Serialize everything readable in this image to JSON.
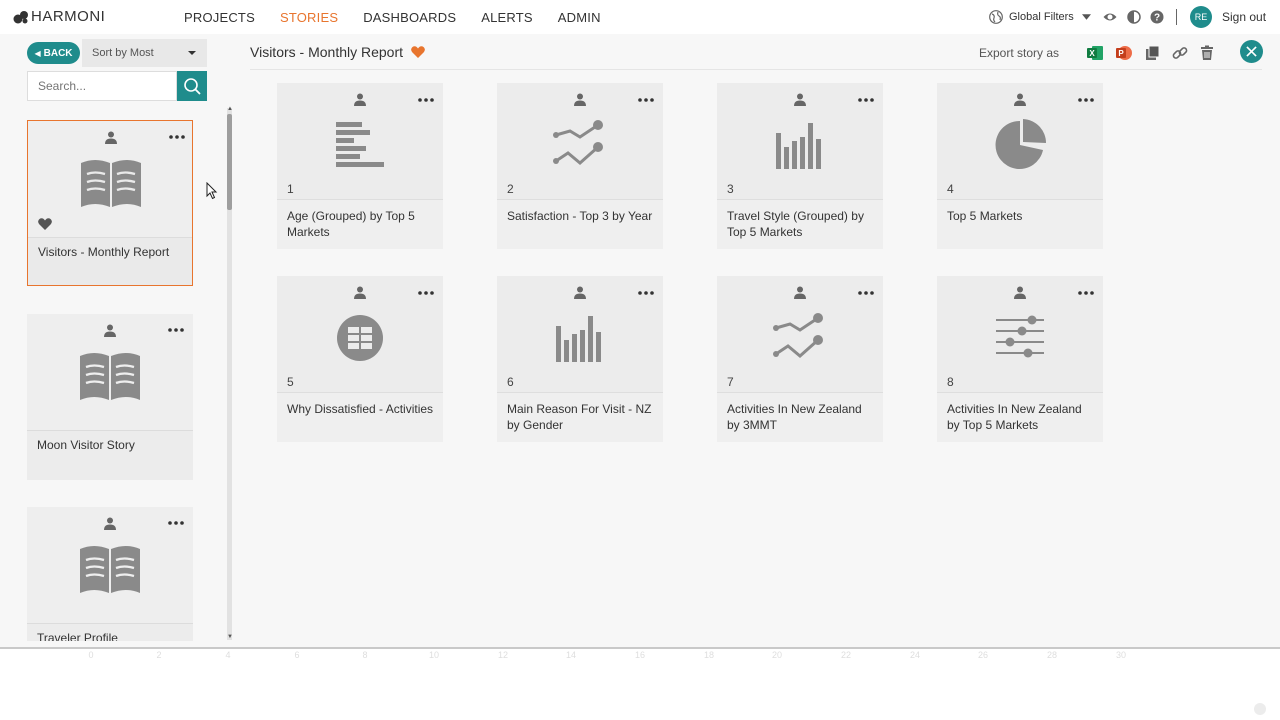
{
  "app": {
    "brand": "HARMONI"
  },
  "nav": {
    "items": [
      {
        "label": "PROJECTS",
        "active": false
      },
      {
        "label": "STORIES",
        "active": true
      },
      {
        "label": "DASHBOARDS",
        "active": false
      },
      {
        "label": "ALERTS",
        "active": false
      },
      {
        "label": "ADMIN",
        "active": false
      }
    ]
  },
  "header_tools": {
    "global_filters": "Global Filters",
    "avatar_initials": "RE",
    "sign_out": "Sign out",
    "icons": [
      "globe-icon",
      "eye-icon",
      "contrast-icon",
      "help-icon"
    ]
  },
  "sidebar": {
    "back_label": "BACK",
    "sort_label": "Sort by Most",
    "search_placeholder": "Search...",
    "stories": [
      {
        "title": "Visitors - Monthly Report",
        "selected": true,
        "favorite": true
      },
      {
        "title": "Moon Visitor Story",
        "selected": false,
        "favorite": false
      },
      {
        "title": "Traveler Profile",
        "selected": false,
        "favorite": false
      }
    ]
  },
  "story": {
    "title": "Visitors - Monthly Report",
    "favorite": true,
    "export_label": "Export story as",
    "export_icons": [
      "excel-icon",
      "powerpoint-icon",
      "copy-icon",
      "link-icon",
      "trash-icon",
      "close-icon"
    ]
  },
  "visualizations": [
    {
      "num": "1",
      "name": "Age (Grouped) by Top 5 Markets",
      "icon": "horizontal-bar-chart-icon"
    },
    {
      "num": "2",
      "name": "Satisfaction - Top 3 by Year",
      "icon": "line-chart-icon"
    },
    {
      "num": "3",
      "name": "Travel Style (Grouped) by Top 5 Markets",
      "icon": "bar-chart-icon"
    },
    {
      "num": "4",
      "name": "Top 5 Markets",
      "icon": "pie-chart-icon"
    },
    {
      "num": "5",
      "name": "Why Dissatisfied - Activities",
      "icon": "table-icon"
    },
    {
      "num": "6",
      "name": "Main Reason For Visit - NZ by Gender",
      "icon": "bar-chart-icon"
    },
    {
      "num": "7",
      "name": "Activities In New Zealand by 3MMT",
      "icon": "line-chart-icon"
    },
    {
      "num": "8",
      "name": "Activities In New Zealand by Top 5 Markets",
      "icon": "filter-sliders-icon"
    }
  ],
  "faint_axis_ticks": [
    "0",
    "2",
    "4",
    "6",
    "8",
    "10",
    "12",
    "14",
    "16",
    "18",
    "20",
    "22",
    "24",
    "26",
    "28",
    "30"
  ],
  "colors": {
    "accent": "#e8752e",
    "teal": "#1f8c8c",
    "icon_gray": "#8a8a8a"
  }
}
